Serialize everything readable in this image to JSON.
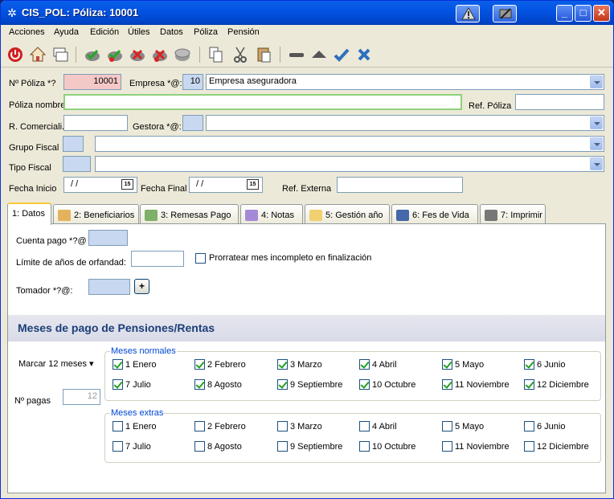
{
  "window": {
    "title": "CIS_POL: Póliza: 10001"
  },
  "menu": [
    "Acciones",
    "Ayuda",
    "Edición",
    "Útiles",
    "Datos",
    "Póliza",
    "Pensión"
  ],
  "form": {
    "poliza_label": "Nº Póliza *?",
    "poliza_value": "10001",
    "empresa_label": "Empresa *@:",
    "empresa_code": "10",
    "empresa_name": "Empresa aseguradora",
    "poliza_nombre_label": "Póliza nombre",
    "poliza_nombre_value": "",
    "ref_poliza_label": "Ref. Póliza",
    "ref_poliza_value": "",
    "r_comercial_label": "R. Comerciali.",
    "r_comercial_value": "",
    "gestora_label": "Gestora *@:",
    "gestora_code": "",
    "gestora_name": "",
    "grupo_fiscal_label": "Grupo Fiscal",
    "tipo_fiscal_label": "Tipo Fiscal",
    "fecha_inicio_label": "Fecha Inicio",
    "fecha_inicio_value": "/ /",
    "fecha_final_label": "Fecha Final",
    "fecha_final_value": "/ /",
    "ref_externa_label": "Ref. Externa",
    "ref_externa_value": "",
    "cal_icon": "15"
  },
  "tabs": [
    "1: Datos",
    "2: Beneficiarios",
    "3: Remesas Pago",
    "4: Notas",
    "5: Gestión año",
    "6: Fes de Vida",
    "7: Imprimir"
  ],
  "datos": {
    "cuenta_pago_label": "Cuenta pago *?@",
    "limite_label": "Límite de años de orfandad:",
    "prorratear_label": "Prorratear mes incompleto en finalización",
    "tomador_label": "Tomador *?@:",
    "plus_label": "+",
    "section_title": "Meses de pago de Pensiones/Rentas",
    "marcar_label": "Marcar 12 meses",
    "npagas_label": "Nº pagas",
    "npagas_value": "12",
    "normales_title": "Meses normales",
    "extras_title": "Meses extras",
    "months": [
      "1 Enero",
      "2 Febrero",
      "3 Marzo",
      "4 Abril",
      "5 Mayo",
      "6 Junio",
      "7 Julio",
      "8 Agosto",
      "9 Septiembre",
      "10 Octubre",
      "11 Noviembre",
      "12 Diciembre"
    ],
    "normales_checked": [
      true,
      true,
      true,
      true,
      true,
      true,
      true,
      true,
      true,
      true,
      true,
      true
    ],
    "extras_checked": [
      false,
      false,
      false,
      false,
      false,
      false,
      false,
      false,
      false,
      false,
      false,
      false
    ]
  }
}
